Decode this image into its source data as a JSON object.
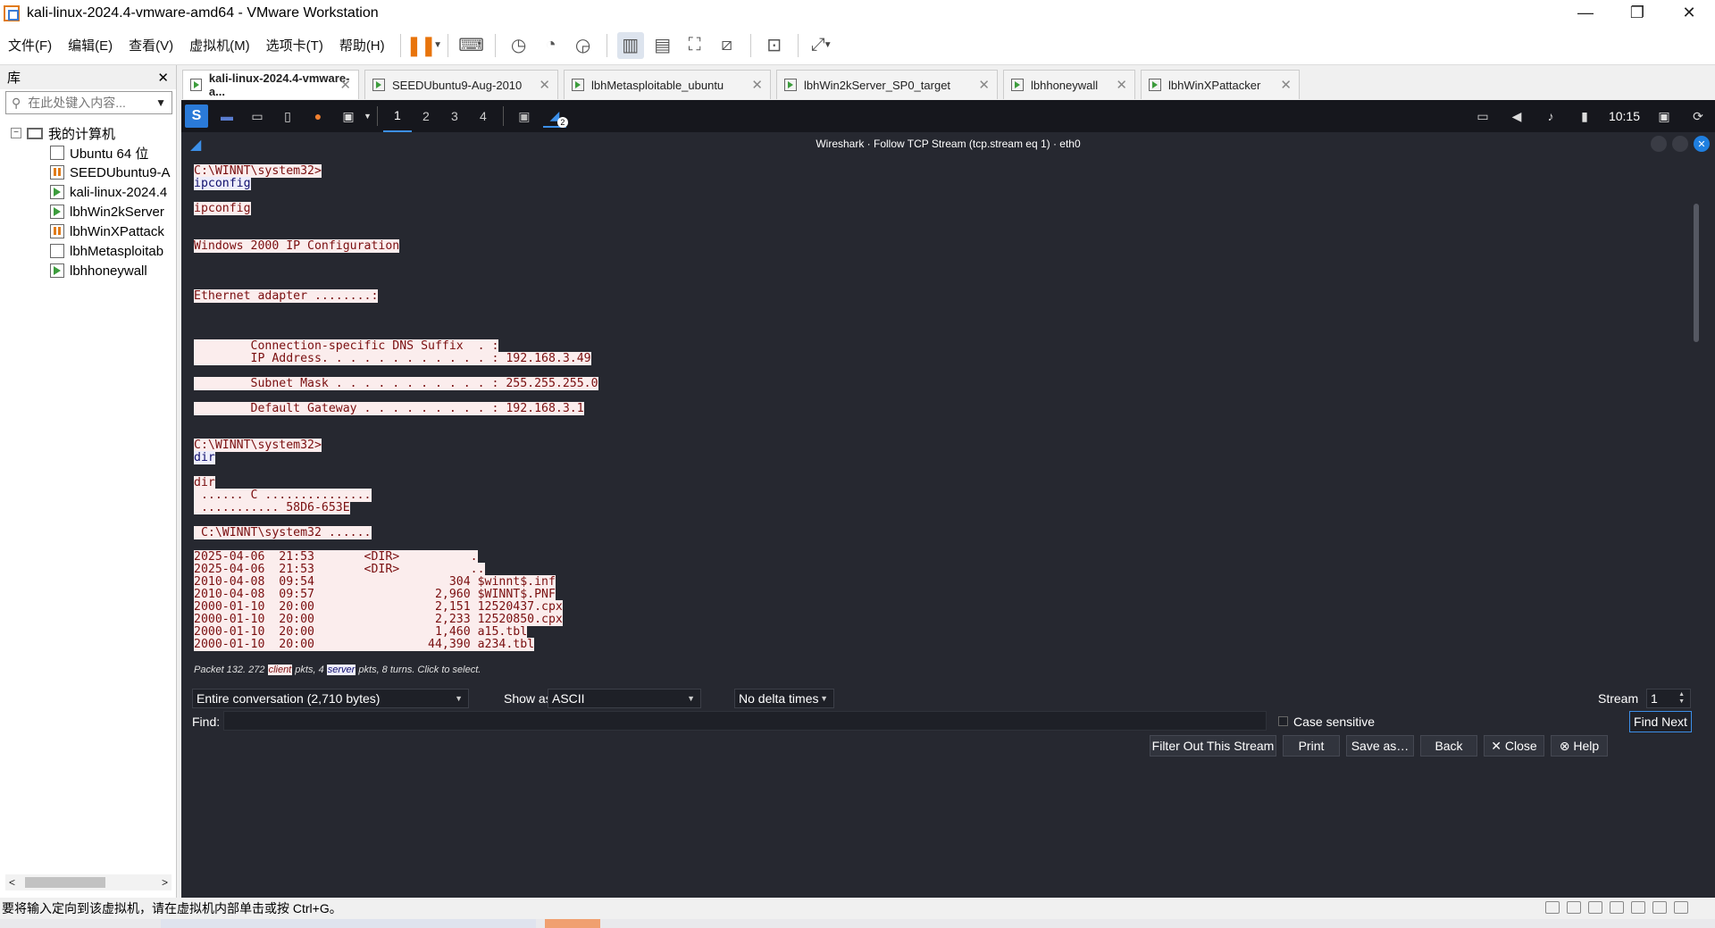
{
  "window": {
    "title": "kali-linux-2024.4-vmware-amd64 - VMware Workstation"
  },
  "menu": {
    "items": [
      "文件(F)",
      "编辑(E)",
      "查看(V)",
      "虚拟机(M)",
      "选项卡(T)",
      "帮助(H)"
    ]
  },
  "library": {
    "title": "库",
    "search_placeholder": "在此处键入内容...",
    "root": "我的计算机",
    "vms": [
      {
        "name": "Ubuntu 64 位",
        "state": "off"
      },
      {
        "name": "SEEDUbuntu9-A",
        "state": "paused"
      },
      {
        "name": "kali-linux-2024.4",
        "state": "running"
      },
      {
        "name": "lbhWin2kServer",
        "state": "running"
      },
      {
        "name": "lbhWinXPattack",
        "state": "paused"
      },
      {
        "name": "lbhMetasploitab",
        "state": "off"
      },
      {
        "name": "lbhhoneywall",
        "state": "running"
      }
    ]
  },
  "tabs": [
    {
      "label": "kali-linux-2024.4-vmware-a...",
      "active": true
    },
    {
      "label": "SEEDUbuntu9-Aug-2010",
      "active": false
    },
    {
      "label": "lbhMetasploitable_ubuntu",
      "active": false
    },
    {
      "label": "lbhWin2kServer_SP0_target",
      "active": false
    },
    {
      "label": "lbhhoneywall",
      "active": false
    },
    {
      "label": "lbhWinXPattacker",
      "active": false
    }
  ],
  "kali_panel": {
    "workspaces": [
      "1",
      "2",
      "3",
      "4"
    ],
    "active_workspace": "1",
    "clock": "10:15",
    "notification_badge": "2"
  },
  "wireshark": {
    "title": "Wireshark · Follow TCP Stream (tcp.stream eq 1) · eth0",
    "stream_lines": [
      {
        "text": "C:\\WINNT\\system32>",
        "side": "client"
      },
      {
        "text": "ipconfig",
        "side": "server"
      },
      {
        "text": "ipconfig",
        "side": "client"
      },
      {
        "text": "Windows 2000 IP Configuration",
        "side": "client"
      },
      {
        "text": "Ethernet adapter ........:",
        "side": "client"
      },
      {
        "text": "        Connection-specific DNS Suffix  . :",
        "side": "client"
      },
      {
        "text": "        IP Address. . . . . . . . . . . . : 192.168.3.49",
        "side": "client"
      },
      {
        "text": "        Subnet Mask . . . . . . . . . . . : 255.255.255.0",
        "side": "client"
      },
      {
        "text": "        Default Gateway . . . . . . . . . : 192.168.3.1",
        "side": "client"
      },
      {
        "text": "C:\\WINNT\\system32>",
        "side": "client"
      },
      {
        "text": "dir",
        "side": "server"
      },
      {
        "text": "dir",
        "side": "client"
      },
      {
        "text": " ...... C ...............",
        "side": "client"
      },
      {
        "text": " ........... 58D6-653E",
        "side": "client"
      },
      {
        "text": " C:\\WINNT\\system32 ......",
        "side": "client"
      },
      {
        "text": "2025-04-06  21:53       <DIR>          .",
        "side": "client"
      },
      {
        "text": "2025-04-06  21:53       <DIR>          ..",
        "side": "client"
      },
      {
        "text": "2010-04-08  09:54                   304 $winnt$.inf",
        "side": "client"
      },
      {
        "text": "2010-04-08  09:57                 2,960 $WINNT$.PNF",
        "side": "client"
      },
      {
        "text": "2000-01-10  20:00                 2,151 12520437.cpx",
        "side": "client"
      },
      {
        "text": "2000-01-10  20:00                 2,233 12520850.cpx",
        "side": "client"
      },
      {
        "text": "2000-01-10  20:00                 1,460 a15.tbl",
        "side": "client"
      },
      {
        "text": "2000-01-10  20:00                44,390 a234.tbl",
        "side": "client"
      }
    ],
    "packet_info_prefix": "Packet 132. 272 ",
    "packet_info_client": "client",
    "packet_info_mid": " pkts, 4 ",
    "packet_info_server": "server",
    "packet_info_suffix": " pkts, 8 turns. Click to select.",
    "conversation": "Entire conversation (2,710 bytes)",
    "show_as_label": "Show as",
    "show_as_value": "ASCII",
    "delta": "No delta times",
    "stream_label": "Stream",
    "stream_value": "1",
    "find_label": "Find:",
    "find_value": "",
    "case_sensitive": "Case sensitive",
    "buttons": {
      "find_next": "Find Next",
      "filter_out": "Filter Out This Stream",
      "print": "Print",
      "save_as": "Save as…",
      "back": "Back",
      "close": "✕ Close",
      "help": "⊗ Help"
    }
  },
  "statusbar": {
    "text": "要将输入定向到该虚拟机，请在虚拟机内部单击或按 Ctrl+G。"
  },
  "colors": {
    "client_bg": "#fbeded",
    "client_fg": "#7a0f10",
    "server_bg": "#ededfb",
    "server_fg": "#11106e",
    "vmware_accent": "#e8740c",
    "kali_blue": "#2a7ad8"
  }
}
